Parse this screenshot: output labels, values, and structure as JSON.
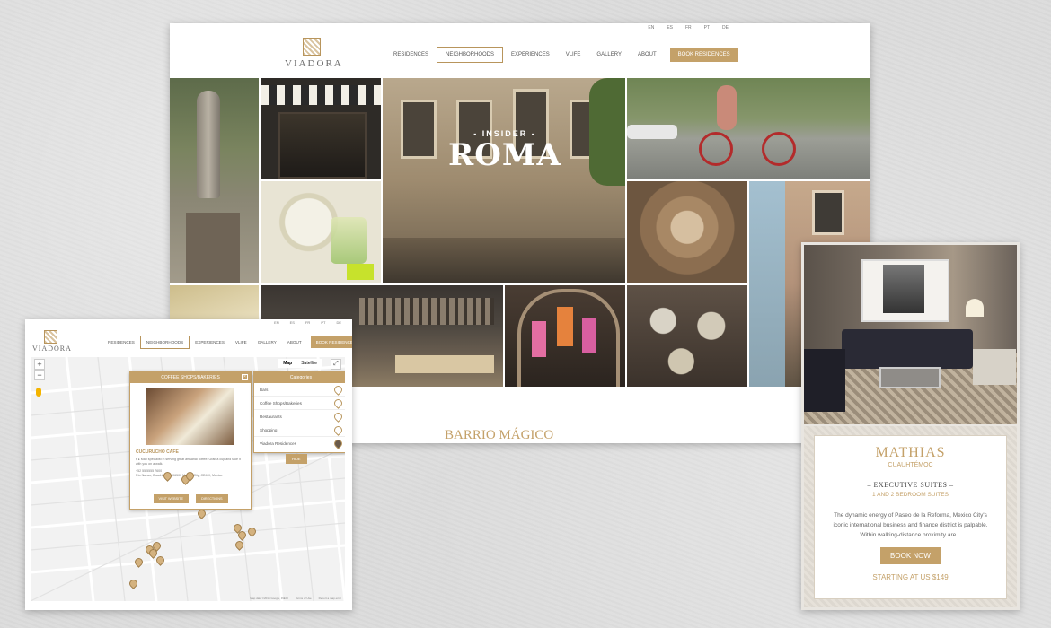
{
  "main": {
    "languages": [
      "EN",
      "ES",
      "FR",
      "PT",
      "DE"
    ],
    "logo_text": "VIADORA",
    "nav": [
      "RESIDENCES",
      "NEIGHBORHOODS",
      "EXPERIENCES",
      "VLIFE",
      "GALLERY",
      "ABOUT"
    ],
    "nav_active": "NEIGHBORHOODS",
    "book_label": "BOOK RESIDENCES",
    "hero_kicker": "- INSIDER -",
    "hero_title": "ROMA",
    "section_title": "BARRIO MÁGICO"
  },
  "map": {
    "languages": [
      "EN",
      "ES",
      "FR",
      "PT",
      "DE"
    ],
    "logo_text": "VIADORA",
    "nav": [
      "RESIDENCES",
      "NEIGHBORHOODS",
      "EXPERIENCES",
      "VLIFE",
      "GALLERY",
      "ABOUT"
    ],
    "book_label": "BOOK RESIDENCES",
    "zoom_in": "+",
    "zoom_out": "−",
    "map_type_map": "Map",
    "map_type_satellite": "Satellite",
    "infobox": {
      "header": "COFFEE SHOPS/BAKERIES",
      "close": "×",
      "place_name": "CUCURUCHO CAFÉ",
      "desc1": "$ ▸ Map specialist in serving great artisanal coffee. Grab a cup and take it with you on a walk.",
      "desc2": "+52 55 5555 7600",
      "desc3": "Río Nazas, Cuauhtémoc, 06500 Mexico City, CDMX, Mexico",
      "visit_label": "VISIT WEBSITE",
      "directions_label": "DIRECTIONS"
    },
    "categories": {
      "header": "Categories",
      "items": [
        "Bars",
        "Coffee Shops/Bakeries",
        "Restaurants",
        "Shopping",
        "Viadora Residences"
      ],
      "hide_label": "HIDE"
    },
    "footer": [
      "Map data ©2016 Google, INEGI",
      "Terms of Use",
      "Report a map error"
    ]
  },
  "mobile": {
    "title": "MATHIAS",
    "neighborhood": "CUAUHTÉMOC",
    "suites": "– EXECUTIVE SUITES –",
    "bedrooms": "1 AND 2 BEDROOM SUITES",
    "description": "The dynamic energy of Paseo de la Reforma, Mexico City's iconic international business and finance district is palpable. Within walking-distance proximity are...",
    "book_label": "BOOK NOW",
    "price": "STARTING AT US $149"
  },
  "colors": {
    "accent": "#c4a169",
    "accent_dark": "#b8955c"
  },
  "icons": [
    "logo-mark-icon",
    "pin-icon",
    "pegman-icon",
    "fullscreen-icon",
    "close-icon"
  ]
}
